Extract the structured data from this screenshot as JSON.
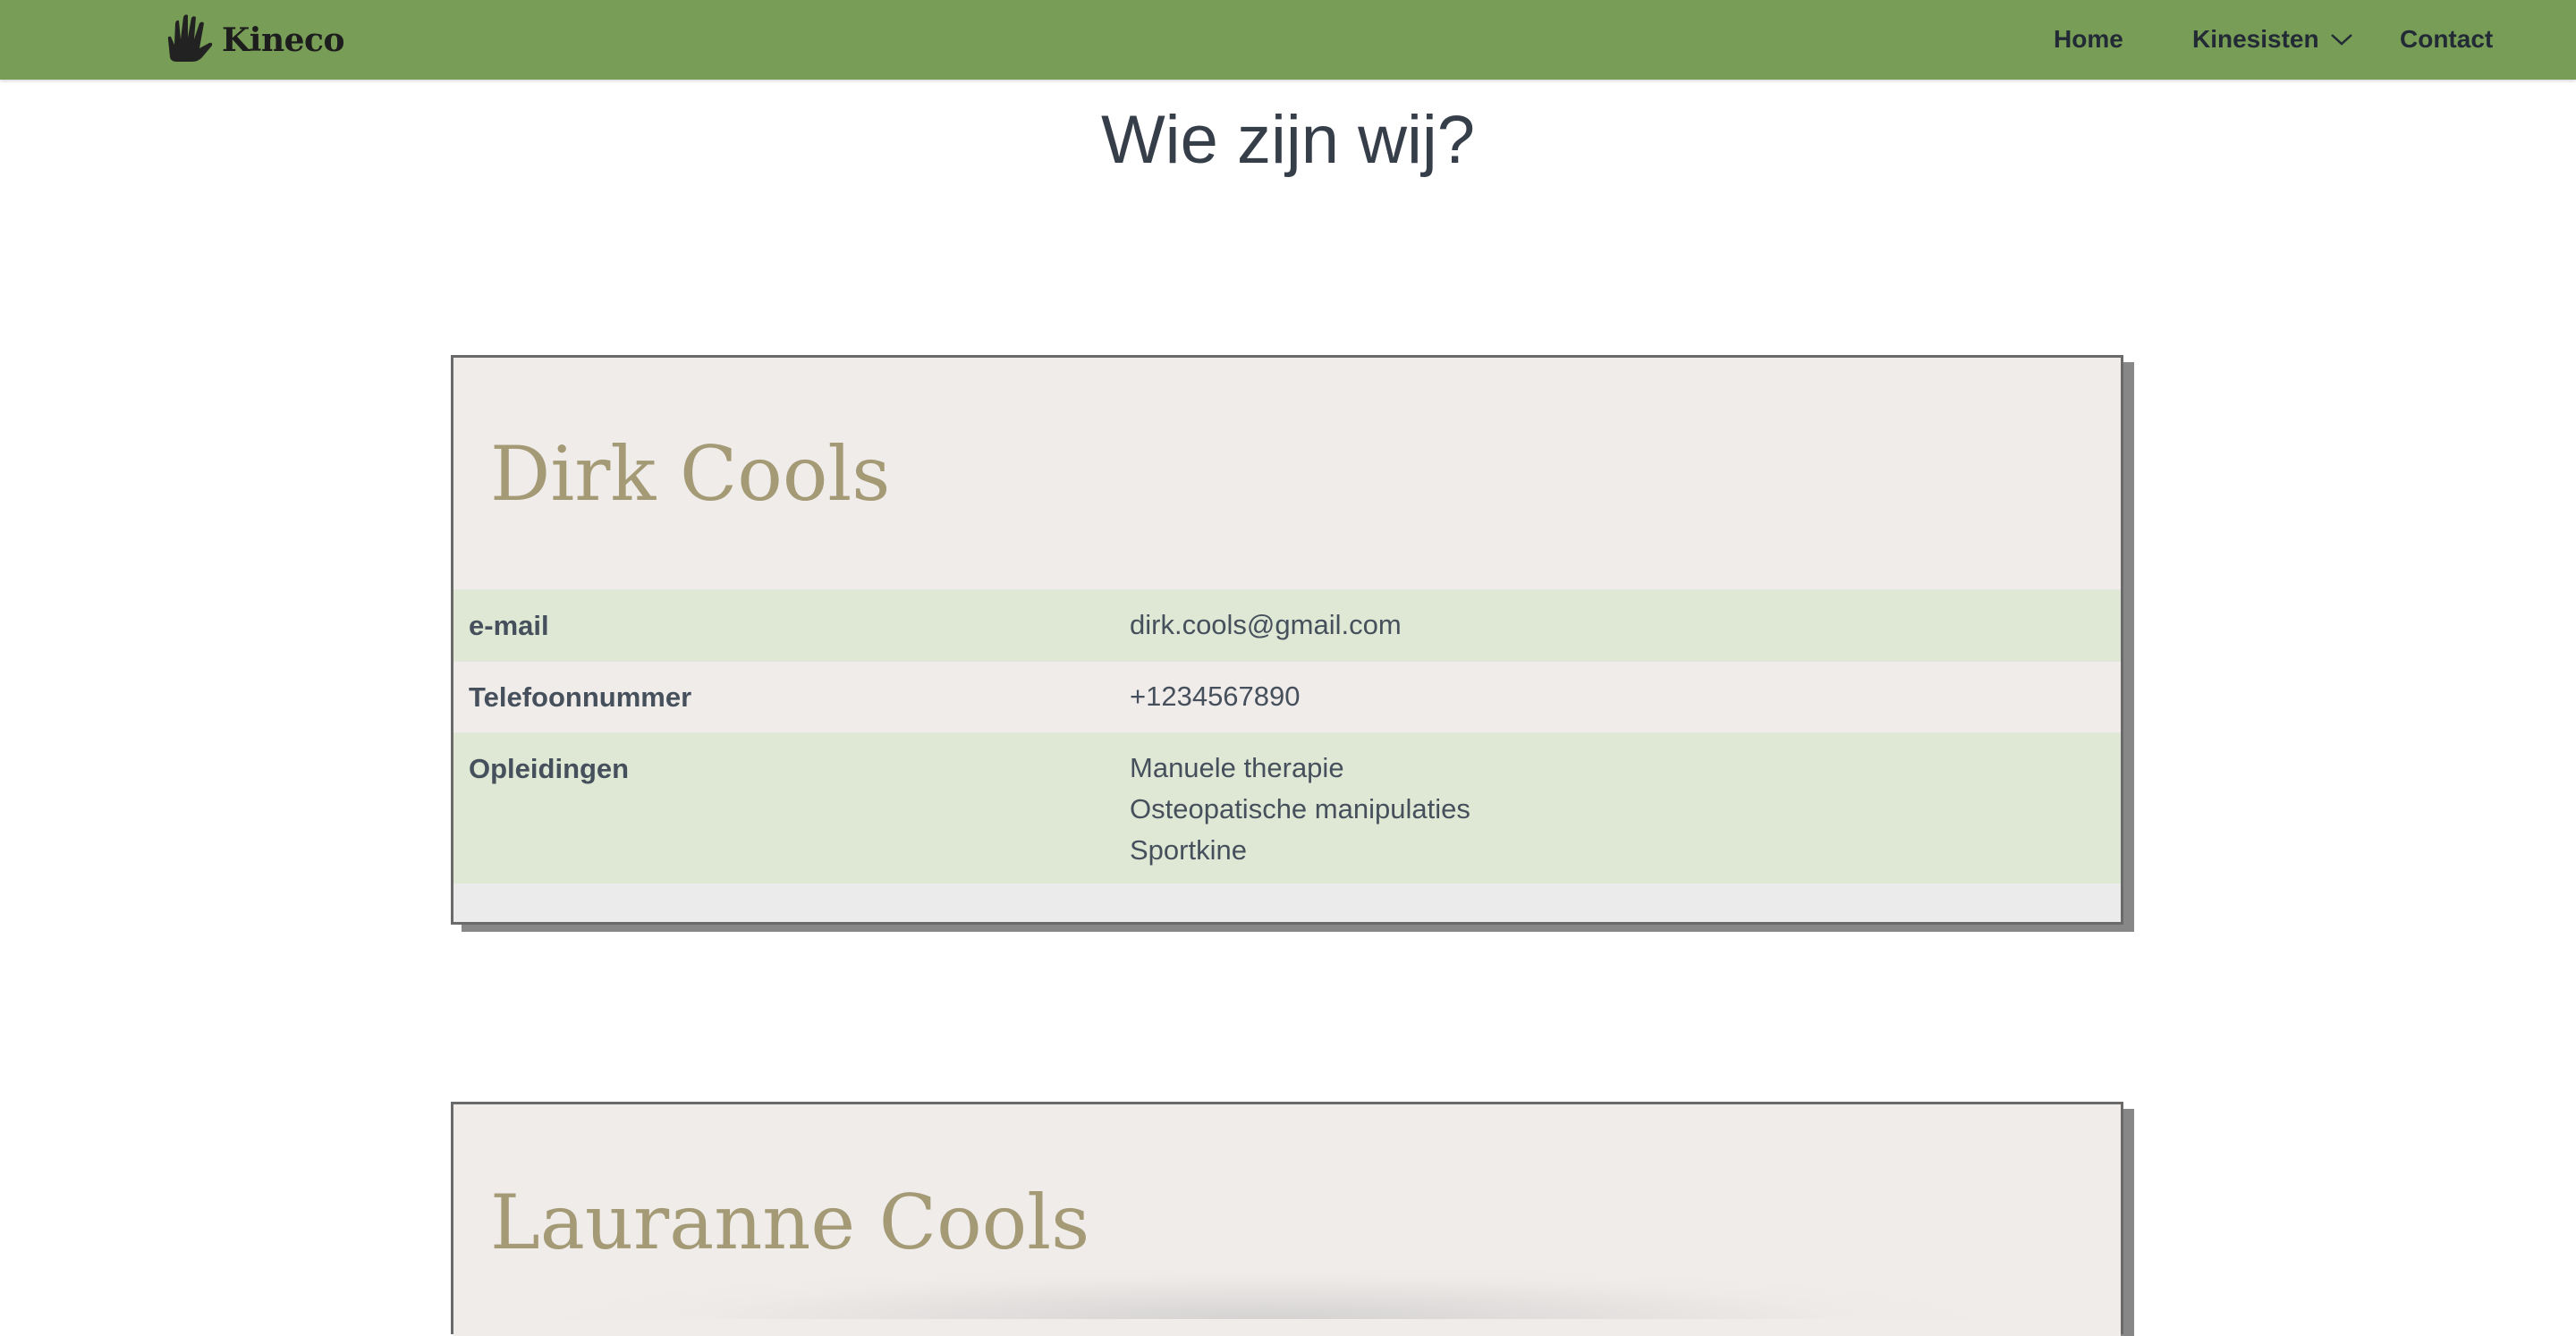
{
  "navbar": {
    "logo_text": "Kineco",
    "items": [
      {
        "label": "Home"
      },
      {
        "label": "Kinesisten",
        "has_dropdown": true
      },
      {
        "label": "Contact"
      }
    ],
    "background_color": "#789d56"
  },
  "page": {
    "title": "Wie zijn wij?"
  },
  "cards": [
    {
      "name": "Dirk Cools",
      "rows": [
        {
          "label": "e-mail",
          "value": "dirk.cools@gmail.com"
        },
        {
          "label": "Telefoonnummer",
          "value": "+1234567890"
        },
        {
          "label": "Opleidingen",
          "values": [
            "Manuele therapie",
            "Osteopatische manipulaties",
            "Sportkine"
          ]
        }
      ]
    },
    {
      "name": "Lauranne Cools"
    }
  ],
  "colors": {
    "accent_green": "#789d56",
    "row_green": "#dfe8d5",
    "card_bg": "#f0ecea",
    "name_color": "#a49a76",
    "text_color": "#46505c"
  },
  "icons": {
    "logo": "hand-icon",
    "dropdown": "chevron-down-icon"
  }
}
